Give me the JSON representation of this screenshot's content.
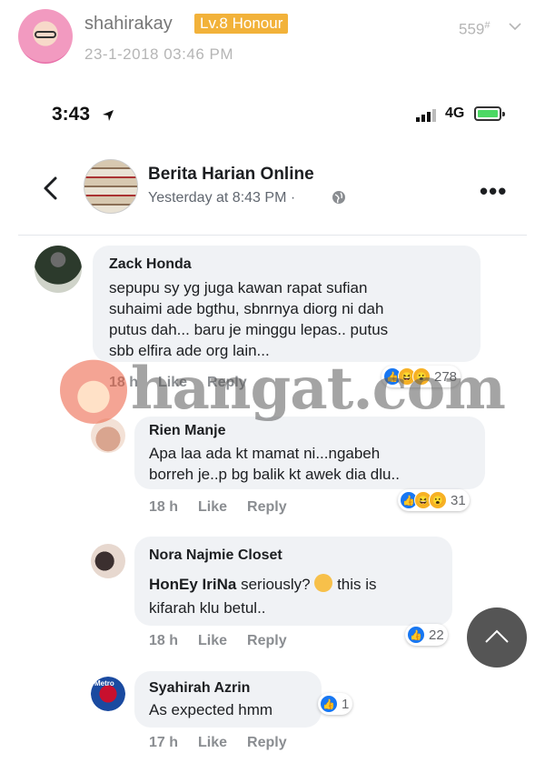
{
  "forum_post": {
    "username": "shahirakay",
    "badge": "Lv.8 Honour",
    "timestamp": "23-1-2018 03:46 PM",
    "floor": "559",
    "floor_mark": "#"
  },
  "status_bar": {
    "time": "3:43",
    "network": "4G"
  },
  "fb_post": {
    "page_name": "Berita Harian Online",
    "time": "Yesterday at 8:43 PM ·"
  },
  "comments": [
    {
      "name": "Zack Honda",
      "lines": [
        "sepupu sy yg juga kawan rapat sufian",
        "suhaimi ade bgthu, sbnrnya diorg ni dah",
        "putus dah... baru je minggu lepas.. putus",
        "sbb elfira ade org lain..."
      ],
      "time": "18 h",
      "like": "Like",
      "reply": "Reply",
      "reaction_count": "278"
    },
    {
      "name": "Rien Manje",
      "lines": [
        "Apa laa ada kt mamat ni...ngabeh",
        "borreh je..p bg balik kt awek dia dlu.."
      ],
      "time": "18 h",
      "like": "Like",
      "reply": "Reply",
      "reaction_count": "31"
    },
    {
      "name": "Nora Najmie Closet",
      "tag": "HonEy IriNa",
      "line1_rest": " seriously? ",
      "line1_tail": " this is",
      "line2": "kifarah klu betul..",
      "time": "18 h",
      "like": "Like",
      "reply": "Reply",
      "reaction_count": "22"
    },
    {
      "name": "Syahirah Azrin",
      "text": "As expected hmm",
      "time": "17 h",
      "like": "Like",
      "reply": "Reply",
      "reaction_count": "1"
    }
  ],
  "watermark": {
    "text": "hangat.com"
  },
  "avatar_labels": {
    "syahirah": "Metro"
  },
  "icons": {
    "back": "back-arrow-icon",
    "more": "more-dots-icon",
    "globe": "globe-icon",
    "location": "location-arrow-icon",
    "scroll_top": "chevron-up-icon",
    "floor_menu": "chevron-down-icon"
  },
  "colors": {
    "badge": "#f2b23a",
    "like_blue": "#1877f2",
    "bubble": "#f0f2f5",
    "scroll_button": "#555555"
  }
}
